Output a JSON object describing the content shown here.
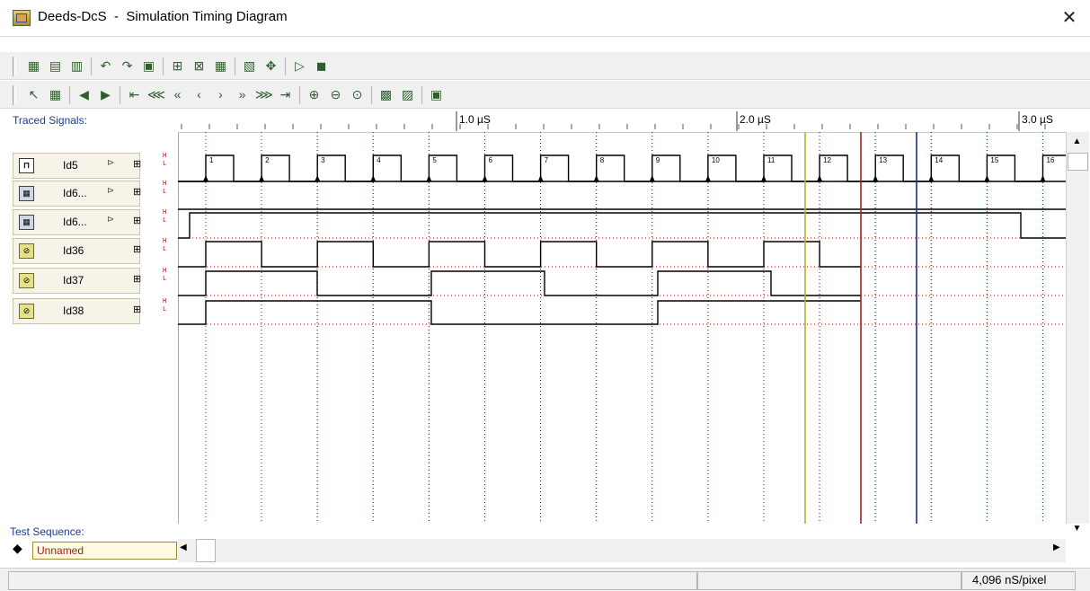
{
  "window": {
    "title": "Deeds-DcS  -  Simulation Timing Diagram",
    "close_glyph": "✕"
  },
  "toolbar1": [
    "new-timing-icon",
    "open-icon",
    "save-icon",
    "undo-icon",
    "redo-icon",
    "copy-icon",
    "add-signal-icon",
    "remove-signal-icon",
    "insert-column-icon",
    "insert-row-icon",
    "select-icon",
    "play-icon",
    "stop-icon"
  ],
  "toolbar2": [
    "pointer-icon",
    "grid-icon",
    "arrow-left-icon",
    "arrow-right-icon",
    "first-icon",
    "fast-rewind-icon",
    "rewind-icon",
    "step-back-icon",
    "step-forward-icon",
    "forward-icon",
    "fast-forward-icon",
    "last-icon",
    "zoom-in-icon",
    "zoom-out-icon",
    "zoom-fit-icon",
    "export-icon",
    "settings-icon",
    "chip-icon"
  ],
  "panel": {
    "traced_label": "Traced Signals:",
    "test_sequence_label": "Test Sequence:",
    "test_sequence_value": "Unnamed"
  },
  "signals": [
    {
      "name": "Id5",
      "kind": "clock",
      "has_arrow": true
    },
    {
      "name": "Id6...",
      "kind": "sequence",
      "has_arrow": true
    },
    {
      "name": "Id6...",
      "kind": "sequence",
      "has_arrow": true
    },
    {
      "name": "Id36",
      "kind": "logic",
      "has_arrow": false
    },
    {
      "name": "Id37",
      "kind": "logic",
      "has_arrow": false
    },
    {
      "name": "Id38",
      "kind": "logic",
      "has_arrow": false
    }
  ],
  "hl_labels": {
    "high": "H",
    "low": "L"
  },
  "ruler": {
    "labels": [
      "1.0 µS",
      "2.0 µS",
      "3.0 µS"
    ]
  },
  "clock_numbers": [
    "1",
    "2",
    "3",
    "4",
    "5",
    "6",
    "7",
    "8",
    "9",
    "10",
    "11",
    "12",
    "13",
    "14",
    "15",
    "16"
  ],
  "colors": {
    "cursor_yellow": "#b5b32a",
    "cursor_red": "#9b2222",
    "cursor_blue": "#1c2f8f",
    "grid": "#c00000",
    "signal": "#000000"
  },
  "status": {
    "zoom": "4,096 nS/pixel"
  }
}
